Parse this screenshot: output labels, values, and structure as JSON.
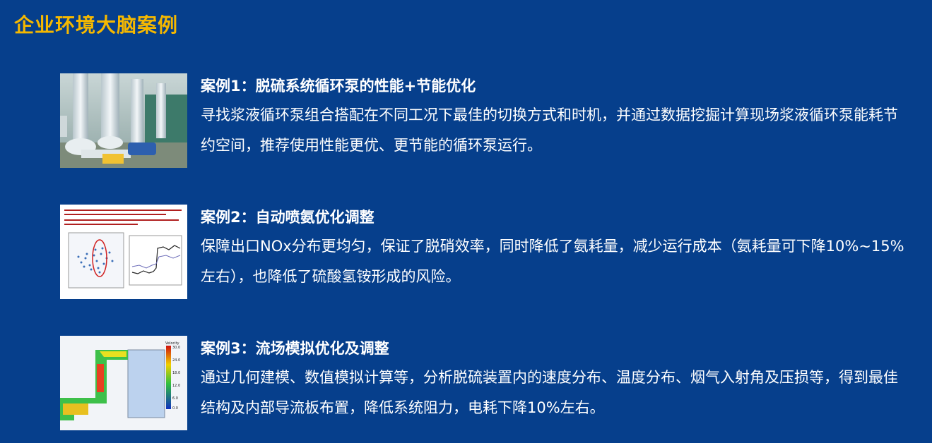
{
  "page": {
    "title": "企业环境大脑案例"
  },
  "cases": [
    {
      "title": "案例1：脱硫系统循环泵的性能+节能优化",
      "body": "寻找浆液循环泵组合搭配在不同工况下最佳的切换方式和时机，并通过数据挖掘计算现场浆液循环泵能耗节约空间，推荐使用性能更优、更节能的循环泵运行。",
      "image_icon": "pump-room-photo"
    },
    {
      "title": "案例2：自动喷氨优化调整",
      "body": "保障出口NOx分布更均匀，保证了脱硝效率，同时降低了氨耗量，减少运行成本（氨耗量可下降10%~15%左右），也降低了硫酸氢铵形成的风险。",
      "image_icon": "nox-analysis-chart"
    },
    {
      "title": "案例3：流场模拟优化及调整",
      "body": "通过几何建模、数值模拟计算等，分析脱硫装置内的速度分布、温度分布、烟气入射角及压损等，得到最佳结构及内部导流板布置，降低系统阻力，电耗下降10%左右。",
      "image_icon": "flow-field-simulation"
    }
  ],
  "colors": {
    "background": "#063f8c",
    "title": "#f5b800",
    "text": "#ffffff"
  }
}
